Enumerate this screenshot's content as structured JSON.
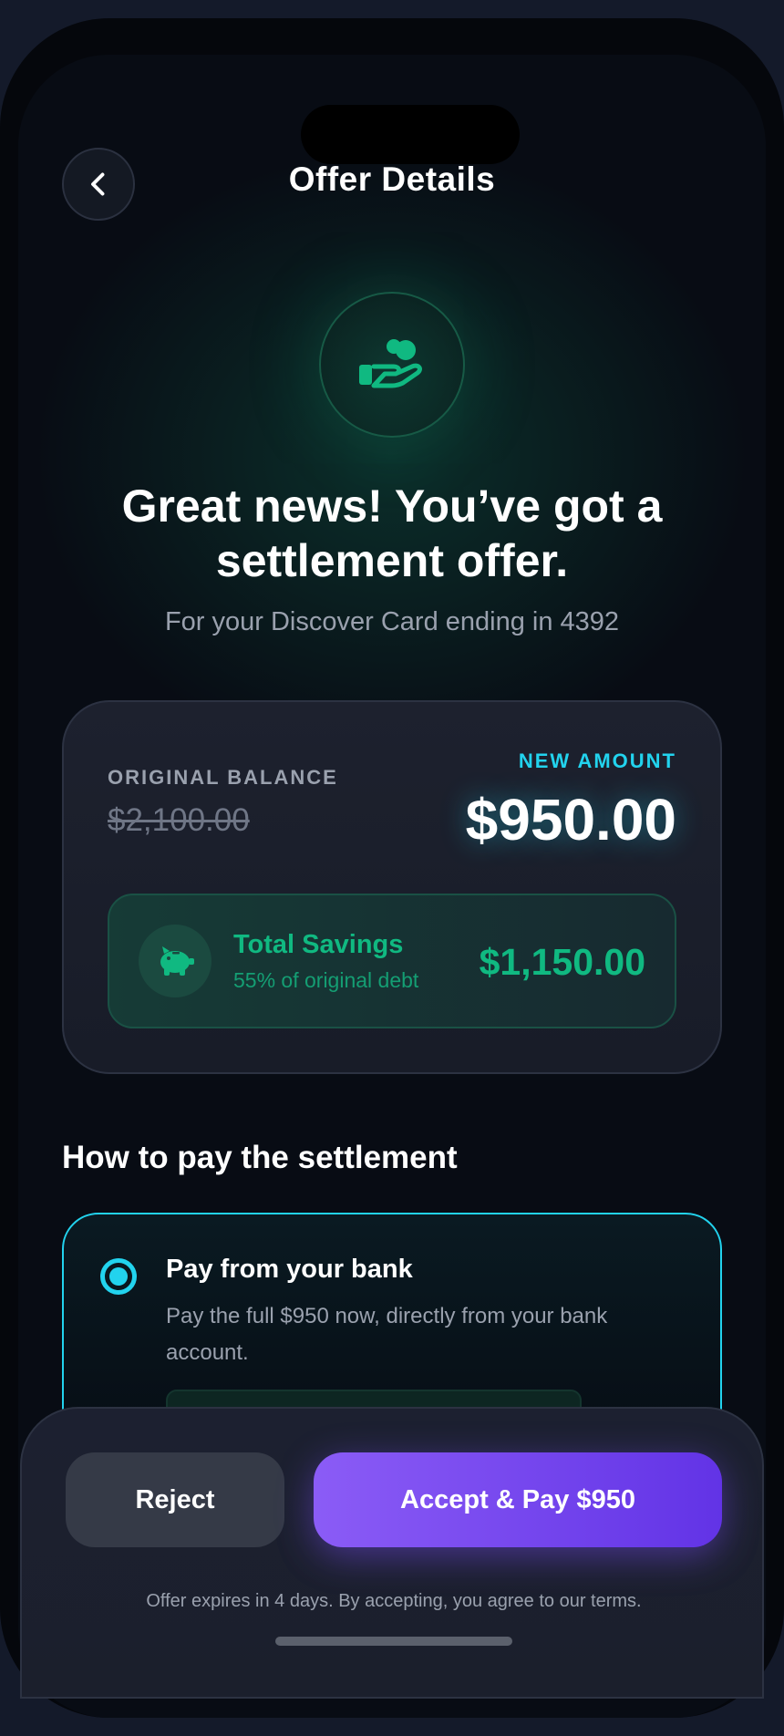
{
  "header": {
    "title": "Offer Details"
  },
  "hero": {
    "headline": "Great news! You’ve got a settlement offer.",
    "subtitle": "For your Discover Card ending in 4392"
  },
  "offer": {
    "original_label": "ORIGINAL BALANCE",
    "original_value": "$2,100.00",
    "new_label": "NEW AMOUNT",
    "new_value": "$950.00",
    "savings": {
      "title": "Total Savings",
      "subtitle": "55% of original debt",
      "amount": "$1,150.00"
    }
  },
  "payment": {
    "section_title": "How to pay the settlement",
    "option": {
      "title": "Pay from your bank",
      "description": "Pay the full $950 now, directly from your bank account.",
      "selected": true
    }
  },
  "actions": {
    "reject_label": "Reject",
    "accept_label": "Accept & Pay $950",
    "terms": "Offer expires in 4 days. By accepting, you agree to our terms."
  },
  "colors": {
    "accent_cyan": "#22d3ee",
    "accent_green": "#10b981",
    "accent_purple": "#7c4dff"
  },
  "icons": {
    "back": "chevron-left-icon",
    "hero": "hand-coin-icon",
    "savings": "piggy-bank-icon"
  }
}
